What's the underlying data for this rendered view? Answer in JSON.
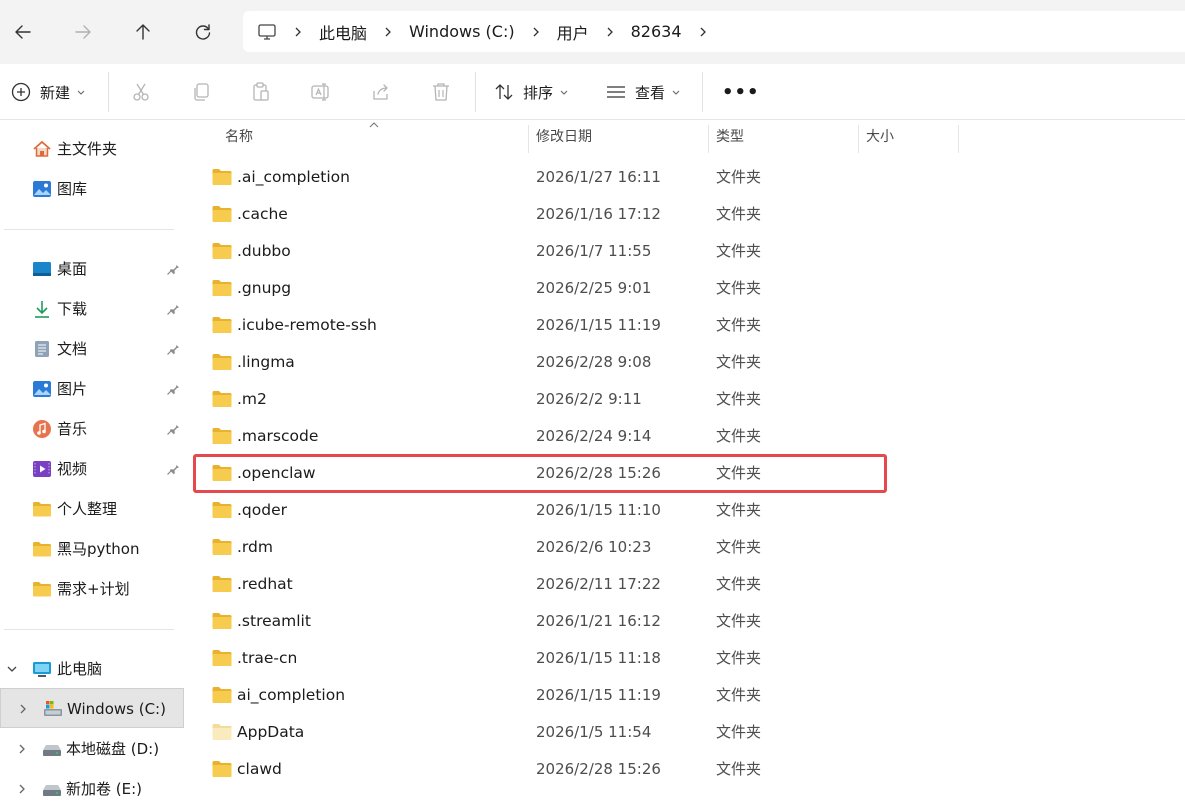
{
  "breadcrumb": [
    "此电脑",
    "Windows (C:)",
    "用户",
    "82634"
  ],
  "toolbar": {
    "new_label": "新建",
    "sort_label": "排序",
    "view_label": "查看",
    "more_label": "•••"
  },
  "sidebar": {
    "quick": [
      {
        "label": "主文件夹",
        "icon": "home-icon"
      },
      {
        "label": "图库",
        "icon": "gallery-icon"
      }
    ],
    "pinned": [
      {
        "label": "桌面",
        "icon": "desktop-icon",
        "pinned": true
      },
      {
        "label": "下载",
        "icon": "download-icon",
        "pinned": true
      },
      {
        "label": "文档",
        "icon": "document-icon",
        "pinned": true
      },
      {
        "label": "图片",
        "icon": "pictures-icon",
        "pinned": true
      },
      {
        "label": "音乐",
        "icon": "music-icon",
        "pinned": true
      },
      {
        "label": "视频",
        "icon": "video-icon",
        "pinned": true
      },
      {
        "label": "个人整理",
        "icon": "folder-icon",
        "pinned": false
      },
      {
        "label": "黑马python",
        "icon": "folder-icon",
        "pinned": false
      },
      {
        "label": "需求+计划",
        "icon": "folder-icon",
        "pinned": false
      }
    ],
    "this_pc": {
      "label": "此电脑",
      "icon": "computer-icon"
    },
    "drives": [
      {
        "label": "Windows (C:)",
        "icon": "drive-icon",
        "selected": true
      },
      {
        "label": "本地磁盘 (D:)",
        "icon": "drive-icon",
        "selected": false
      },
      {
        "label": "新加卷 (E:)",
        "icon": "drive-icon",
        "selected": false
      }
    ]
  },
  "columns": {
    "name": "名称",
    "date": "修改日期",
    "type": "类型",
    "size": "大小"
  },
  "files": [
    {
      "name": ".ai_completion",
      "date": "2026/1/27 16:11",
      "type": "文件夹"
    },
    {
      "name": ".cache",
      "date": "2026/1/16 17:12",
      "type": "文件夹"
    },
    {
      "name": ".dubbo",
      "date": "2026/1/7 11:55",
      "type": "文件夹"
    },
    {
      "name": ".gnupg",
      "date": "2026/2/25 9:01",
      "type": "文件夹"
    },
    {
      "name": ".icube-remote-ssh",
      "date": "2026/1/15 11:19",
      "type": "文件夹"
    },
    {
      "name": ".lingma",
      "date": "2026/2/28 9:08",
      "type": "文件夹"
    },
    {
      "name": ".m2",
      "date": "2026/2/2 9:11",
      "type": "文件夹"
    },
    {
      "name": ".marscode",
      "date": "2026/2/24 9:14",
      "type": "文件夹"
    },
    {
      "name": ".openclaw",
      "date": "2026/2/28 15:26",
      "type": "文件夹",
      "highlighted": true
    },
    {
      "name": ".qoder",
      "date": "2026/1/15 11:10",
      "type": "文件夹"
    },
    {
      "name": ".rdm",
      "date": "2026/2/6 10:23",
      "type": "文件夹"
    },
    {
      "name": ".redhat",
      "date": "2026/2/11 17:22",
      "type": "文件夹"
    },
    {
      "name": ".streamlit",
      "date": "2026/1/21 16:12",
      "type": "文件夹"
    },
    {
      "name": ".trae-cn",
      "date": "2026/1/15 11:18",
      "type": "文件夹"
    },
    {
      "name": "ai_completion",
      "date": "2026/1/15 11:19",
      "type": "文件夹"
    },
    {
      "name": "AppData",
      "date": "2026/1/5 11:54",
      "type": "文件夹",
      "hidden_style": true
    },
    {
      "name": "clawd",
      "date": "2026/2/28 15:26",
      "type": "文件夹"
    }
  ],
  "colors": {
    "highlight": "#e5484d",
    "folder": "#f5c542",
    "accent": "#0067c0"
  }
}
